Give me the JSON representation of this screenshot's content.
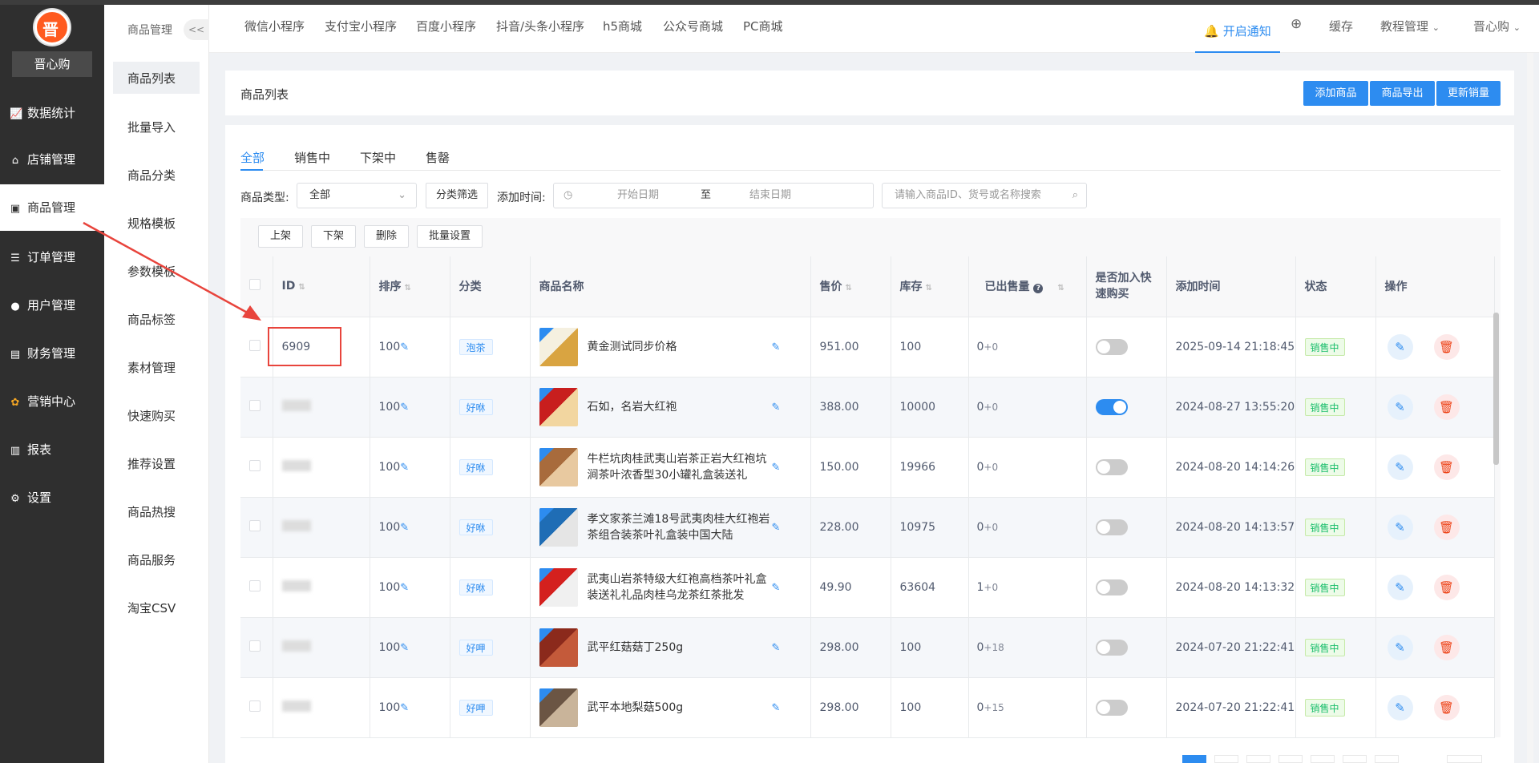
{
  "brand": {
    "name": "晋心购",
    "logo_text": "晋"
  },
  "sidebar": {
    "items": [
      {
        "label": "数据统计",
        "icon": "chart-icon"
      },
      {
        "label": "店铺管理",
        "icon": "home-icon"
      },
      {
        "label": "商品管理",
        "icon": "product-icon"
      },
      {
        "label": "订单管理",
        "icon": "order-icon"
      },
      {
        "label": "用户管理",
        "icon": "user-icon"
      },
      {
        "label": "财务管理",
        "icon": "finance-icon"
      },
      {
        "label": "营销中心",
        "icon": "marketing-icon"
      },
      {
        "label": "报表",
        "icon": "report-icon"
      },
      {
        "label": "设置",
        "icon": "settings-icon"
      }
    ]
  },
  "submenu": {
    "title": "商品管理",
    "collapse": "<<",
    "items": [
      "商品列表",
      "批量导入",
      "商品分类",
      "规格模板",
      "参数模板",
      "商品标签",
      "素材管理",
      "快速购买",
      "推荐设置",
      "商品热搜",
      "商品服务",
      "淘宝CSV"
    ]
  },
  "topbar": {
    "tabs": [
      "微信小程序",
      "支付宝小程序",
      "百度小程序",
      "抖音/头条小程序",
      "h5商城",
      "公众号商城",
      "PC商城"
    ],
    "notify": "开启通知",
    "cache": "缓存",
    "tutorial": "教程管理",
    "user": "晋心购"
  },
  "page": {
    "title": "商品列表",
    "buttons": [
      "添加商品",
      "商品导出",
      "更新销量"
    ]
  },
  "status_tabs": [
    "全部",
    "销售中",
    "下架中",
    "售罄"
  ],
  "filters": {
    "type_label": "商品类型:",
    "type_value": "全部",
    "category_btn": "分类筛选",
    "time_label": "添加时间:",
    "start_placeholder": "开始日期",
    "sep": "至",
    "end_placeholder": "结束日期",
    "search_placeholder": "请输入商品ID、货号或名称搜索"
  },
  "batch": [
    "上架",
    "下架",
    "删除",
    "批量设置"
  ],
  "table": {
    "headers": [
      "ID",
      "排序",
      "分类",
      "商品名称",
      "售价",
      "库存",
      "已出售量",
      "是否加入快速购买",
      "添加时间",
      "状态",
      "操作"
    ],
    "rows": [
      {
        "id": "6909",
        "sort": "100",
        "cat": "泡茶",
        "name": "黄金测试同步价格",
        "price": "951.00",
        "stock": "100",
        "sold": "0",
        "sold_add": "+0",
        "quick": false,
        "time": "2025-09-14 21:18:45",
        "status": "销售中"
      },
      {
        "id": "",
        "sort": "100",
        "cat": "好咻",
        "name": "石如，名岩大红袍",
        "price": "388.00",
        "stock": "10000",
        "sold": "0",
        "sold_add": "+0",
        "quick": true,
        "time": "2024-08-27 13:55:20",
        "status": "销售中"
      },
      {
        "id": "",
        "sort": "100",
        "cat": "好咻",
        "name": "牛栏坑肉桂武夷山岩茶正岩大红袍坑涧茶叶浓香型30小罐礼盒装送礼",
        "price": "150.00",
        "stock": "19966",
        "sold": "0",
        "sold_add": "+0",
        "quick": false,
        "time": "2024-08-20 14:14:26",
        "status": "销售中"
      },
      {
        "id": "",
        "sort": "100",
        "cat": "好咻",
        "name": "孝文家茶兰滩18号武夷肉桂大红袍岩茶组合装茶叶礼盒装中国大陆",
        "price": "228.00",
        "stock": "10975",
        "sold": "0",
        "sold_add": "+0",
        "quick": false,
        "time": "2024-08-20 14:13:57",
        "status": "销售中"
      },
      {
        "id": "",
        "sort": "100",
        "cat": "好咻",
        "name": "武夷山岩茶特级大红袍高档茶叶礼盒装送礼礼品肉桂乌龙茶红茶批发",
        "price": "49.90",
        "stock": "63604",
        "sold": "1",
        "sold_add": "+0",
        "quick": false,
        "time": "2024-08-20 14:13:32",
        "status": "销售中"
      },
      {
        "id": "",
        "sort": "100",
        "cat": "好呷",
        "name": "武平红菇菇丁250g",
        "price": "298.00",
        "stock": "100",
        "sold": "0",
        "sold_add": "+18",
        "quick": false,
        "time": "2024-07-20 21:22:41",
        "status": "销售中"
      },
      {
        "id": "",
        "sort": "100",
        "cat": "好呷",
        "name": "武平本地梨菇500g",
        "price": "298.00",
        "stock": "100",
        "sold": "0",
        "sold_add": "+15",
        "quick": false,
        "time": "2024-07-20 21:22:41",
        "status": "销售中"
      }
    ]
  },
  "colors": {
    "accent": "#2d8cf0",
    "sidebar": "#2f2f2f",
    "highlight": "#e8443c",
    "success": "#19be6b",
    "danger": "#ed4014"
  }
}
